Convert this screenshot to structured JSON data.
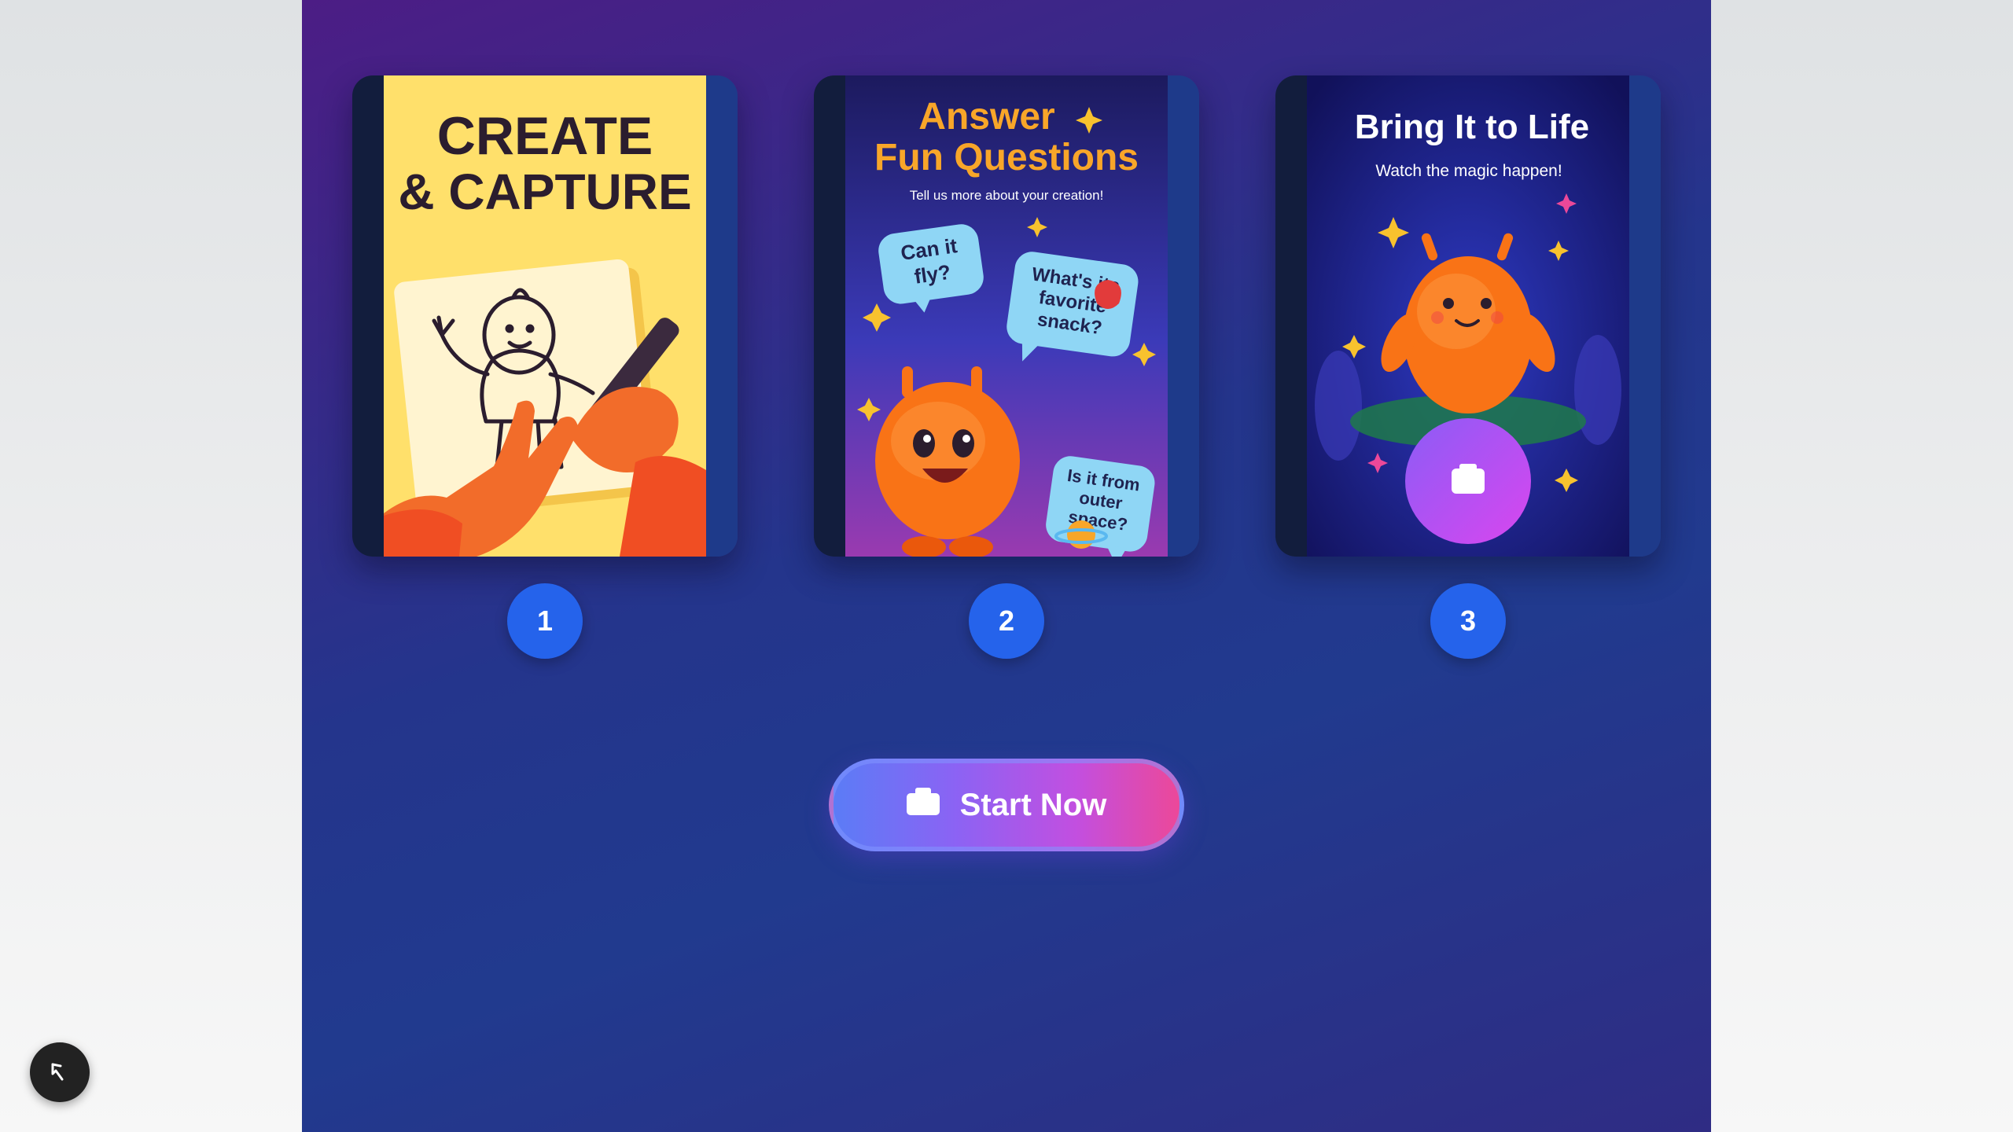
{
  "cards": [
    {
      "step": "1",
      "title_line1": "CREATE",
      "title_line2": "& CAPTURE",
      "colors": {
        "bg": "#ffe06b",
        "paper": "#fff4d0",
        "hand": "#f26c2a"
      }
    },
    {
      "step": "2",
      "title_line1": "Answer",
      "title_line2": "Fun Questions",
      "subtitle": "Tell us more about your creation!",
      "bubbles": [
        [
          "Can it",
          "fly?"
        ],
        [
          "What's its",
          "favorite",
          "snack?"
        ],
        [
          "Is it from",
          "outer",
          "space?"
        ]
      ],
      "colors": {
        "title": "#f8a629",
        "bubble": "#8fd6f5"
      }
    },
    {
      "step": "3",
      "title": "Bring It to Life",
      "subtitle": "Watch the magic happen!",
      "colors": {
        "bg": "#1a1a6e",
        "creature": "#f97316",
        "button": "#c050f0"
      }
    }
  ],
  "start_button": {
    "label": "Start Now",
    "icon": "camera-icon"
  },
  "corner_button": {
    "icon": "cursor-arrow-icon"
  },
  "colors": {
    "accent": "#2563eb",
    "panel_top": "#4c1d85",
    "panel_bottom": "#2f2c84"
  }
}
